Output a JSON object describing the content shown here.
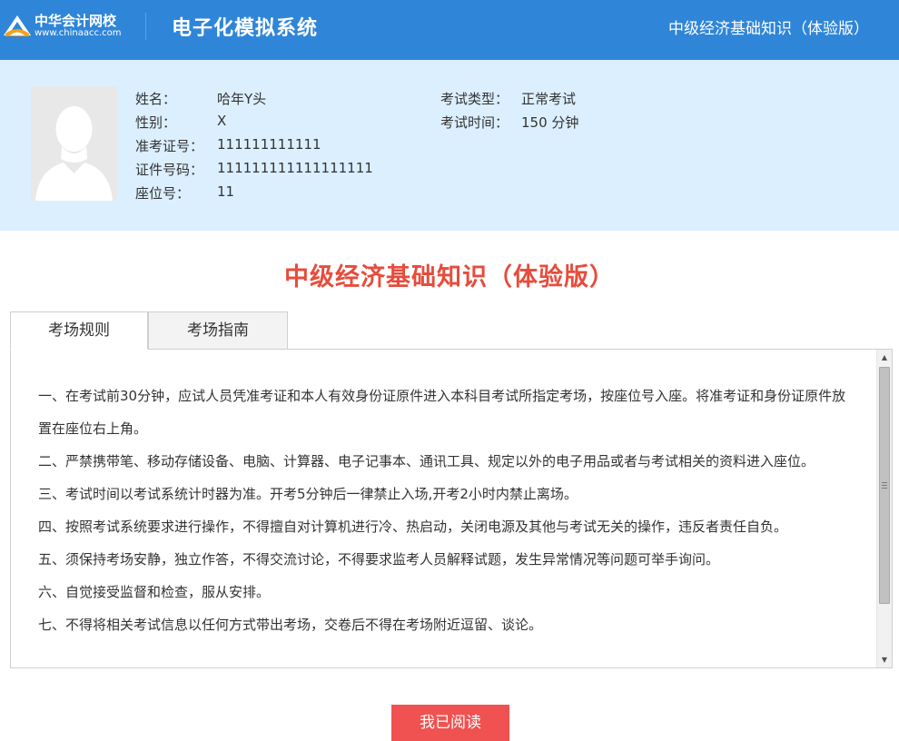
{
  "header": {
    "logo_name": "中华会计网校",
    "logo_url": "www.chinaacc.com",
    "system_title": "电子化模拟系统",
    "exam_name": "中级经济基础知识（体验版）"
  },
  "candidate": {
    "name_label": "姓名：",
    "name_value": "哈年Y头",
    "gender_label": "性别：",
    "gender_value": "X",
    "ticket_label": "准考证号：",
    "ticket_value": "111111111111",
    "id_label": "证件号码：",
    "id_value": "111111111111111111",
    "seat_label": "座位号：",
    "seat_value": "11",
    "exam_type_label": "考试类型：",
    "exam_type_value": "正常考试",
    "exam_time_label": "考试时间：",
    "exam_time_value": "150 分钟"
  },
  "main": {
    "exam_title": "中级经济基础知识（体验版）",
    "tabs": [
      {
        "label": "考场规则",
        "active": true
      },
      {
        "label": "考场指南",
        "active": false
      }
    ],
    "rules": [
      "一、在考试前30分钟，应试人员凭准考证和本人有效身份证原件进入本科目考试所指定考场，按座位号入座。将准考证和身份证原件放置在座位右上角。",
      "二、严禁携带笔、移动存储设备、电脑、计算器、电子记事本、通讯工具、规定以外的电子用品或者与考试相关的资料进入座位。",
      "三、考试时间以考试系统计时器为准。开考5分钟后一律禁止入场,开考2小时内禁止离场。",
      "四、按照考试系统要求进行操作，不得擅自对计算机进行冷、热启动，关闭电源及其他与考试无关的操作，违反者责任自负。",
      "五、须保持考场安静，独立作答，不得交流讨论，不得要求监考人员解释试题，发生异常情况等问题可举手询问。",
      "六、自觉接受监督和检查，服从安排。",
      "七、不得将相关考试信息以任何方式带出考场，交卷后不得在考场附近逗留、谈论。"
    ],
    "confirm_label": "我已阅读"
  },
  "colors": {
    "header_bg": "#2f86d8",
    "info_bg": "#dcefff",
    "title_red": "#e74c3c",
    "button_red": "#ef5250"
  },
  "icons": {
    "logo": "chinaacc-logo-icon",
    "avatar": "default-person-silhouette",
    "scroll_up": "scroll-up-arrow-icon",
    "scroll_down": "scroll-down-arrow-icon"
  }
}
